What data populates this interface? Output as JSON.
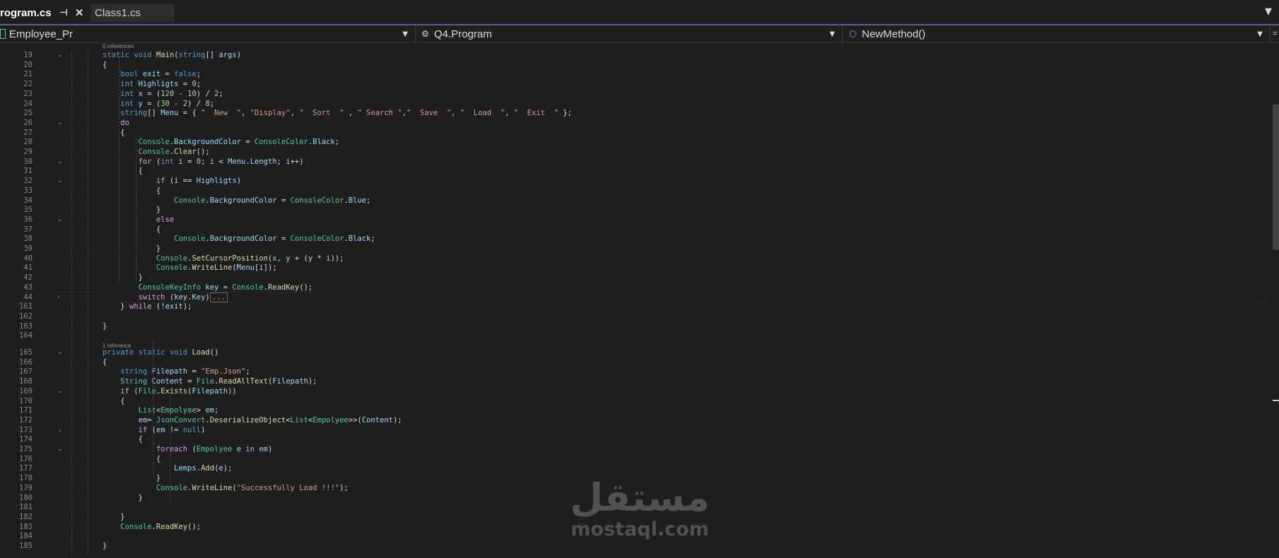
{
  "tabs": [
    {
      "label": "rogram.cs",
      "active": true
    },
    {
      "label": "Class1.cs",
      "active": false
    }
  ],
  "tab_icons": {
    "pin": "pin-icon",
    "close": "close-icon",
    "overflow": "chevron-down-icon"
  },
  "nav": {
    "project": "Employee_Pr",
    "class": "Q4.Program",
    "member": "NewMethod()"
  },
  "code_lens": [
    {
      "text": "0 references",
      "before_line": "19"
    },
    {
      "text": "1 reference",
      "before_line": "165"
    }
  ],
  "code_lines": [
    {
      "n": "19",
      "fold": "v",
      "tokens": [
        [
          "kw",
          "static "
        ],
        [
          "kw",
          "void "
        ],
        [
          "mt",
          "Main"
        ],
        [
          "pl",
          "("
        ],
        [
          "kw",
          "string"
        ],
        [
          "pl",
          "[] "
        ],
        [
          "vr",
          "args"
        ],
        [
          "pl",
          ")"
        ]
      ]
    },
    {
      "n": "20",
      "tokens": [
        [
          "pl",
          "{"
        ]
      ]
    },
    {
      "n": "21",
      "tokens": [
        [
          "kw",
          "    bool "
        ],
        [
          "vr",
          "exit"
        ],
        [
          "pl",
          " = "
        ],
        [
          "kw",
          "false"
        ],
        [
          "pl",
          ";"
        ]
      ]
    },
    {
      "n": "22",
      "tokens": [
        [
          "kw",
          "    int "
        ],
        [
          "vr",
          "Highligts"
        ],
        [
          "pl",
          " = "
        ],
        [
          "nm",
          "0"
        ],
        [
          "pl",
          ";"
        ]
      ]
    },
    {
      "n": "23",
      "tokens": [
        [
          "kw",
          "    int "
        ],
        [
          "vr",
          "x"
        ],
        [
          "pl",
          " = ("
        ],
        [
          "nm",
          "120"
        ],
        [
          "pl",
          " - "
        ],
        [
          "nm",
          "10"
        ],
        [
          "pl",
          ") / "
        ],
        [
          "nm",
          "2"
        ],
        [
          "pl",
          ";"
        ]
      ]
    },
    {
      "n": "24",
      "tokens": [
        [
          "kw",
          "    int "
        ],
        [
          "vr",
          "y"
        ],
        [
          "pl",
          " = ("
        ],
        [
          "nm",
          "30"
        ],
        [
          "pl",
          " - "
        ],
        [
          "nm",
          "2"
        ],
        [
          "pl",
          ") / "
        ],
        [
          "nm",
          "8"
        ],
        [
          "pl",
          ";"
        ]
      ]
    },
    {
      "n": "25",
      "tokens": [
        [
          "kw",
          "    string"
        ],
        [
          "pl",
          "[] "
        ],
        [
          "vr",
          "Menu"
        ],
        [
          "pl",
          " = { "
        ],
        [
          "st",
          "\"  New  \""
        ],
        [
          "pl",
          ", "
        ],
        [
          "st",
          "\"Display\""
        ],
        [
          "pl",
          ", "
        ],
        [
          "st",
          "\"  Sort  \""
        ],
        [
          "pl",
          " , "
        ],
        [
          "st",
          "\" Search \""
        ],
        [
          "pl",
          ","
        ],
        [
          "st",
          "\"  Save  \""
        ],
        [
          "pl",
          ", "
        ],
        [
          "st",
          "\"  Load  \""
        ],
        [
          "pl",
          ", "
        ],
        [
          "st",
          "\"  Exit  \""
        ],
        [
          "pl",
          " };"
        ]
      ]
    },
    {
      "n": "26",
      "fold": "v",
      "tokens": [
        [
          "ct",
          "    do"
        ]
      ]
    },
    {
      "n": "27",
      "tokens": [
        [
          "pl",
          "    {"
        ]
      ]
    },
    {
      "n": "28",
      "tokens": [
        [
          "ty",
          "        Console"
        ],
        [
          "pl",
          "."
        ],
        [
          "vr",
          "BackgroundColor"
        ],
        [
          "pl",
          " = "
        ],
        [
          "ty",
          "ConsoleColor"
        ],
        [
          "pl",
          "."
        ],
        [
          "vr",
          "Black"
        ],
        [
          "pl",
          ";"
        ]
      ]
    },
    {
      "n": "29",
      "tokens": [
        [
          "ty",
          "        Console"
        ],
        [
          "pl",
          "."
        ],
        [
          "mt",
          "Clear"
        ],
        [
          "pl",
          "();"
        ]
      ]
    },
    {
      "n": "30",
      "fold": "v",
      "tokens": [
        [
          "ct",
          "        for "
        ],
        [
          "pl",
          "("
        ],
        [
          "kw",
          "int "
        ],
        [
          "vr",
          "i"
        ],
        [
          "pl",
          " = "
        ],
        [
          "nm",
          "0"
        ],
        [
          "pl",
          "; "
        ],
        [
          "vr",
          "i"
        ],
        [
          "pl",
          " < "
        ],
        [
          "vr",
          "Menu"
        ],
        [
          "pl",
          "."
        ],
        [
          "vr",
          "Length"
        ],
        [
          "pl",
          "; "
        ],
        [
          "vr",
          "i"
        ],
        [
          "pl",
          "++)"
        ]
      ]
    },
    {
      "n": "31",
      "tokens": [
        [
          "pl",
          "        {"
        ]
      ]
    },
    {
      "n": "32",
      "fold": "v",
      "tokens": [
        [
          "ct",
          "            if "
        ],
        [
          "pl",
          "("
        ],
        [
          "vr",
          "i"
        ],
        [
          "pl",
          " == "
        ],
        [
          "vr",
          "Highligts"
        ],
        [
          "pl",
          ")"
        ]
      ]
    },
    {
      "n": "33",
      "tokens": [
        [
          "pl",
          "            {"
        ]
      ]
    },
    {
      "n": "34",
      "tokens": [
        [
          "ty",
          "                Console"
        ],
        [
          "pl",
          "."
        ],
        [
          "vr",
          "BackgroundColor"
        ],
        [
          "pl",
          " = "
        ],
        [
          "ty",
          "ConsoleColor"
        ],
        [
          "pl",
          "."
        ],
        [
          "vr",
          "Blue"
        ],
        [
          "pl",
          ";"
        ]
      ]
    },
    {
      "n": "35",
      "tokens": [
        [
          "pl",
          "            }"
        ]
      ]
    },
    {
      "n": "36",
      "fold": "v",
      "tokens": [
        [
          "ct",
          "            else"
        ]
      ]
    },
    {
      "n": "37",
      "tokens": [
        [
          "pl",
          "            {"
        ]
      ]
    },
    {
      "n": "38",
      "tokens": [
        [
          "ty",
          "                Console"
        ],
        [
          "pl",
          "."
        ],
        [
          "vr",
          "BackgroundColor"
        ],
        [
          "pl",
          " = "
        ],
        [
          "ty",
          "ConsoleColor"
        ],
        [
          "pl",
          "."
        ],
        [
          "vr",
          "Black"
        ],
        [
          "pl",
          ";"
        ]
      ]
    },
    {
      "n": "39",
      "tokens": [
        [
          "pl",
          "            }"
        ]
      ]
    },
    {
      "n": "40",
      "tokens": [
        [
          "ty",
          "            Console"
        ],
        [
          "pl",
          "."
        ],
        [
          "mt",
          "SetCursorPosition"
        ],
        [
          "pl",
          "("
        ],
        [
          "vr",
          "x"
        ],
        [
          "pl",
          ", "
        ],
        [
          "vr",
          "y"
        ],
        [
          "pl",
          " + ("
        ],
        [
          "vr",
          "y"
        ],
        [
          "pl",
          " * "
        ],
        [
          "vr",
          "i"
        ],
        [
          "pl",
          "));"
        ]
      ]
    },
    {
      "n": "41",
      "tokens": [
        [
          "ty",
          "            Console"
        ],
        [
          "pl",
          "."
        ],
        [
          "mt",
          "WriteLine"
        ],
        [
          "pl",
          "("
        ],
        [
          "vr",
          "Menu"
        ],
        [
          "pl",
          "["
        ],
        [
          "vr",
          "i"
        ],
        [
          "pl",
          "]);"
        ]
      ]
    },
    {
      "n": "42",
      "tokens": [
        [
          "pl",
          "        }"
        ]
      ]
    },
    {
      "n": "43",
      "tokens": [
        [
          "ty",
          "        ConsoleKeyInfo "
        ],
        [
          "vr",
          "key"
        ],
        [
          "pl",
          " = "
        ],
        [
          "ty",
          "Console"
        ],
        [
          "pl",
          "."
        ],
        [
          "mt",
          "ReadKey"
        ],
        [
          "pl",
          "();"
        ]
      ]
    },
    {
      "n": "44",
      "fold": ">",
      "tokens": [
        [
          "ct",
          "        switch "
        ],
        [
          "pl",
          "("
        ],
        [
          "vr",
          "key"
        ],
        [
          "pl",
          "."
        ],
        [
          "vr",
          "Key"
        ],
        [
          "pl",
          ")"
        ],
        [
          "collapsed",
          "..."
        ]
      ]
    },
    {
      "n": "161",
      "tokens": [
        [
          "pl",
          "    } "
        ],
        [
          "ct",
          "while "
        ],
        [
          "pl",
          "(!"
        ],
        [
          "vr",
          "exit"
        ],
        [
          "pl",
          ");"
        ]
      ]
    },
    {
      "n": "162",
      "tokens": []
    },
    {
      "n": "163",
      "tokens": [
        [
          "pl",
          "}"
        ]
      ]
    },
    {
      "n": "164",
      "tokens": []
    },
    {
      "n": "165",
      "fold": "v",
      "tokens": [
        [
          "kw",
          "private "
        ],
        [
          "kw",
          "static "
        ],
        [
          "kw",
          "void "
        ],
        [
          "mt",
          "Load"
        ],
        [
          "pl",
          "()"
        ]
      ]
    },
    {
      "n": "166",
      "tokens": [
        [
          "pl",
          "{"
        ]
      ]
    },
    {
      "n": "167",
      "tokens": [
        [
          "kw",
          "    string "
        ],
        [
          "vr",
          "Filepath"
        ],
        [
          "pl",
          " = "
        ],
        [
          "st",
          "\"Emp.Json\""
        ],
        [
          "pl",
          ";"
        ]
      ]
    },
    {
      "n": "168",
      "tokens": [
        [
          "ty",
          "    String "
        ],
        [
          "vr",
          "Content"
        ],
        [
          "pl",
          " = "
        ],
        [
          "ty",
          "File"
        ],
        [
          "pl",
          "."
        ],
        [
          "mt",
          "ReadAllText"
        ],
        [
          "pl",
          "("
        ],
        [
          "vr",
          "Filepath"
        ],
        [
          "pl",
          ");"
        ]
      ]
    },
    {
      "n": "169",
      "fold": "v",
      "tokens": [
        [
          "ct",
          "    if "
        ],
        [
          "pl",
          "("
        ],
        [
          "ty",
          "File"
        ],
        [
          "pl",
          "."
        ],
        [
          "mt",
          "Exists"
        ],
        [
          "pl",
          "("
        ],
        [
          "vr",
          "Filepath"
        ],
        [
          "pl",
          "))"
        ]
      ]
    },
    {
      "n": "170",
      "tokens": [
        [
          "pl",
          "    {"
        ]
      ]
    },
    {
      "n": "171",
      "tokens": [
        [
          "ty",
          "        List"
        ],
        [
          "pl",
          "<"
        ],
        [
          "ty",
          "Empolyee"
        ],
        [
          "pl",
          "> "
        ],
        [
          "vr",
          "em"
        ],
        [
          "pl",
          ";"
        ]
      ]
    },
    {
      "n": "172",
      "tokens": [
        [
          "vr",
          "        em"
        ],
        [
          "pl",
          "= "
        ],
        [
          "ty",
          "JsonConvert"
        ],
        [
          "pl",
          "."
        ],
        [
          "mt",
          "DeserializeObject"
        ],
        [
          "pl",
          "<"
        ],
        [
          "ty",
          "List"
        ],
        [
          "pl",
          "<"
        ],
        [
          "ty",
          "Empolyee"
        ],
        [
          "pl",
          ">>("
        ],
        [
          "vr",
          "Content"
        ],
        [
          "pl",
          ");"
        ]
      ]
    },
    {
      "n": "173",
      "fold": "v",
      "tokens": [
        [
          "ct",
          "        if "
        ],
        [
          "pl",
          "("
        ],
        [
          "vr",
          "em"
        ],
        [
          "pl",
          " != "
        ],
        [
          "kw",
          "null"
        ],
        [
          "pl",
          ")"
        ]
      ]
    },
    {
      "n": "174",
      "tokens": [
        [
          "pl",
          "        {"
        ]
      ]
    },
    {
      "n": "175",
      "fold": "v",
      "tokens": [
        [
          "ct",
          "            foreach "
        ],
        [
          "pl",
          "("
        ],
        [
          "ty",
          "Empolyee "
        ],
        [
          "vr",
          "e"
        ],
        [
          "ct",
          " in "
        ],
        [
          "vr",
          "em"
        ],
        [
          "pl",
          ")"
        ]
      ]
    },
    {
      "n": "176",
      "tokens": [
        [
          "pl",
          "            {"
        ]
      ]
    },
    {
      "n": "177",
      "tokens": [
        [
          "vr",
          "                Lemps"
        ],
        [
          "pl",
          "."
        ],
        [
          "mt",
          "Add"
        ],
        [
          "pl",
          "("
        ],
        [
          "vr",
          "e"
        ],
        [
          "pl",
          ");"
        ]
      ]
    },
    {
      "n": "178",
      "tokens": [
        [
          "pl",
          "            }"
        ]
      ]
    },
    {
      "n": "179",
      "tokens": [
        [
          "ty",
          "            Console"
        ],
        [
          "pl",
          "."
        ],
        [
          "mt",
          "WriteLine"
        ],
        [
          "pl",
          "("
        ],
        [
          "st",
          "\"Successfully Load !!!\""
        ],
        [
          "pl",
          ");"
        ]
      ]
    },
    {
      "n": "180",
      "tokens": [
        [
          "pl",
          "        }"
        ]
      ]
    },
    {
      "n": "181",
      "tokens": []
    },
    {
      "n": "182",
      "tokens": [
        [
          "pl",
          "    }"
        ]
      ]
    },
    {
      "n": "183",
      "tokens": [
        [
          "ty",
          "    Console"
        ],
        [
          "pl",
          "."
        ],
        [
          "mt",
          "ReadKey"
        ],
        [
          "pl",
          "();"
        ]
      ]
    },
    {
      "n": "184",
      "tokens": []
    },
    {
      "n": "185",
      "tokens": [
        [
          "pl",
          "}"
        ]
      ]
    }
  ],
  "watermark": {
    "arabic": "مستقل",
    "latin": "mostaql.com"
  },
  "colors": {
    "accent": "#6b50b4",
    "background": "#1e1e1e",
    "keyword": "#569cd6",
    "control": "#d8a0df",
    "type": "#4ec9b0",
    "string": "#d69d85",
    "method": "#dcdcaa",
    "variable": "#9cdcfe",
    "number": "#b5cea8"
  }
}
